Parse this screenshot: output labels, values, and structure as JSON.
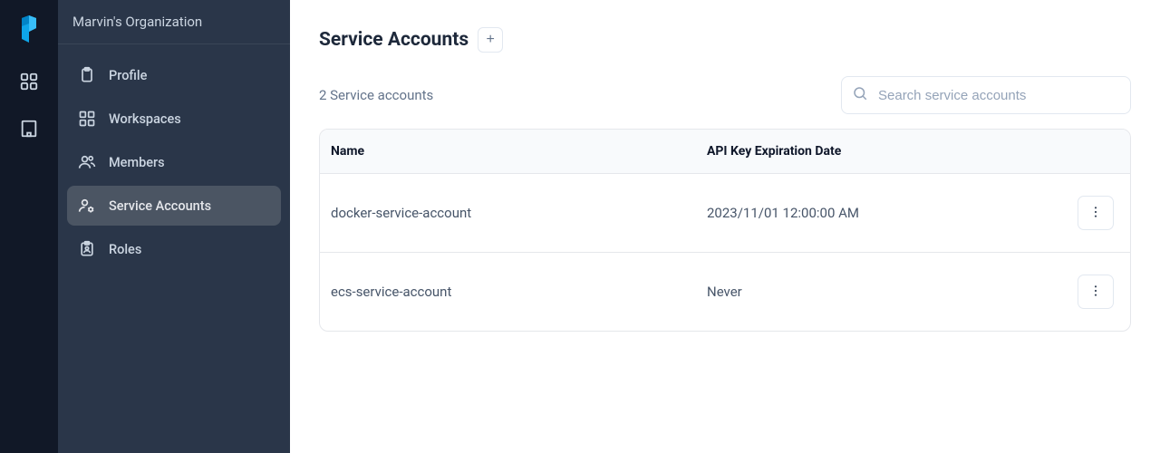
{
  "org": {
    "name": "Marvin's Organization"
  },
  "sidebar": {
    "items": [
      {
        "label": "Profile"
      },
      {
        "label": "Workspaces"
      },
      {
        "label": "Members"
      },
      {
        "label": "Service Accounts"
      },
      {
        "label": "Roles"
      }
    ]
  },
  "page": {
    "title": "Service Accounts",
    "add_label": "+",
    "count_text": "2 Service accounts"
  },
  "search": {
    "placeholder": "Search service accounts"
  },
  "table": {
    "headers": {
      "name": "Name",
      "expiration": "API Key Expiration Date"
    },
    "rows": [
      {
        "name": "docker-service-account",
        "expiration": "2023/11/01 12:00:00 AM"
      },
      {
        "name": "ecs-service-account",
        "expiration": "Never"
      }
    ]
  }
}
